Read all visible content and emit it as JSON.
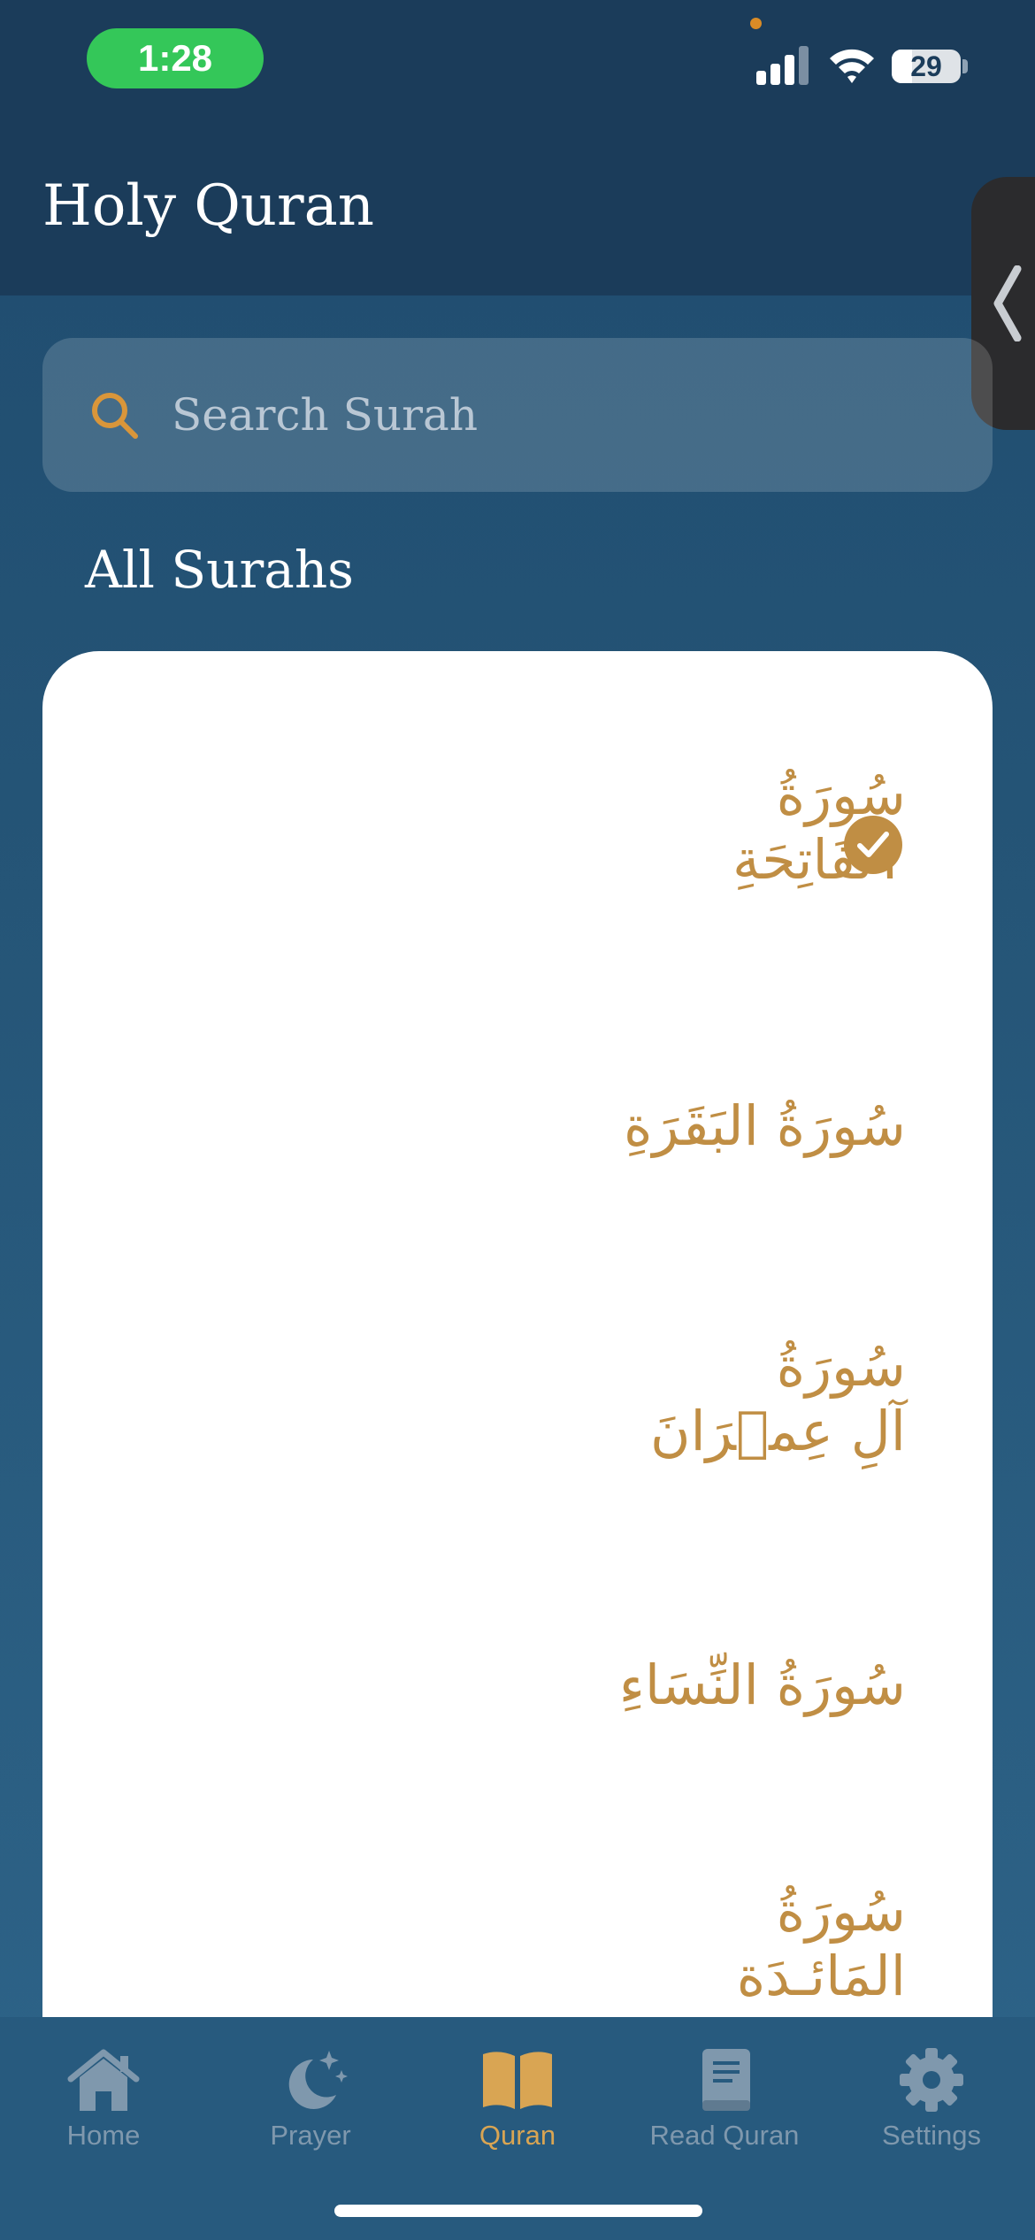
{
  "status_bar": {
    "time": "1:28",
    "battery": "29",
    "icons": [
      "cellular-signal-icon",
      "wifi-icon",
      "battery-icon"
    ]
  },
  "header": {
    "title": "Holy Quran"
  },
  "search": {
    "placeholder": "Search Surah",
    "value": "",
    "icon": "search-icon"
  },
  "list": {
    "section_title": "All Surahs",
    "surahs": [
      {
        "name_line1": "سُورَةُ",
        "name_line2": "ٱلْفَاتِحَةِ",
        "selected": true
      },
      {
        "name_line1": "سُورَةُ البَقَرَةِ",
        "name_line2": "",
        "selected": false
      },
      {
        "name_line1": "سُورَةُ",
        "name_line2": "آلِ عِمۡرَانَ",
        "selected": false
      },
      {
        "name_line1": "سُورَةُ النِّسَاءِ",
        "name_line2": "",
        "selected": false
      },
      {
        "name_line1": "سُورَةُ",
        "name_line2": "المَائـدَة",
        "selected": false
      }
    ]
  },
  "tabs": [
    {
      "label": "Home",
      "icon": "home-icon",
      "active": false
    },
    {
      "label": "Prayer",
      "icon": "moon-stars-icon",
      "active": false
    },
    {
      "label": "Quran",
      "icon": "open-book-icon",
      "active": true
    },
    {
      "label": "Read Quran",
      "icon": "book-icon",
      "active": false
    },
    {
      "label": "Settings",
      "icon": "gear-icon",
      "active": false
    }
  ],
  "colors": {
    "accent_gold": "#c08e44",
    "header_bg": "#1b3c5a",
    "tab_inactive": "#7f98ad",
    "tab_active": "#d9a553"
  }
}
